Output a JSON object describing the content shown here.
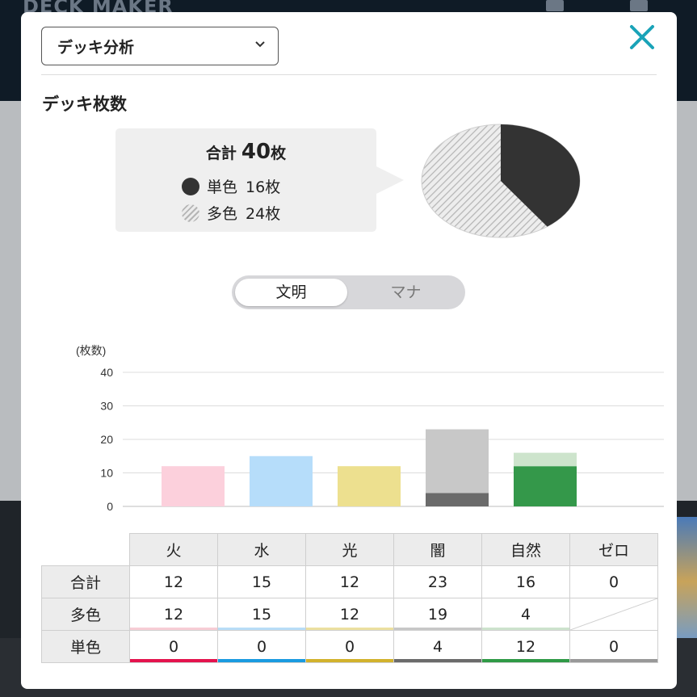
{
  "background": {
    "logo_text": "DECK MAKER"
  },
  "modal": {
    "select": {
      "value": "デッキ分析"
    },
    "section_title": "デッキ枚数",
    "summary": {
      "total_label": "合計",
      "total_value": "40",
      "unit": "枚",
      "mono": {
        "label": "単色",
        "value": "16枚",
        "count": 16
      },
      "multi": {
        "label": "多色",
        "value": "24枚",
        "count": 24
      }
    },
    "toggle": {
      "options": [
        "文明",
        "マナ"
      ],
      "active": 0
    },
    "colors": {
      "close_icon": "#1aa3b8",
      "pie_mono": "#333333",
      "pie_multi_hatch": "#b5b5b5"
    },
    "table": {
      "columns": [
        "火",
        "水",
        "光",
        "闇",
        "自然",
        "ゼロ"
      ],
      "rows": [
        {
          "label": "合計",
          "values": [
            "12",
            "15",
            "12",
            "23",
            "16",
            "0"
          ]
        },
        {
          "label": "多色",
          "values": [
            "12",
            "15",
            "12",
            "19",
            "4",
            ""
          ]
        },
        {
          "label": "単色",
          "values": [
            "0",
            "0",
            "0",
            "4",
            "12",
            "0"
          ]
        }
      ]
    }
  },
  "chart_data": {
    "type": "bar",
    "stacked": true,
    "ylabel": "(枚数)",
    "ylim": [
      0,
      40
    ],
    "yticks": [
      0,
      10,
      20,
      30,
      40
    ],
    "grid": true,
    "categories": [
      "火",
      "水",
      "光",
      "闇",
      "自然",
      "ゼロ"
    ],
    "series": [
      {
        "values": [
          0,
          0,
          0,
          4,
          12,
          0
        ]
      },
      {
        "values": [
          12,
          15,
          12,
          19,
          4,
          0
        ]
      }
    ],
    "colors": {
      "dark": [
        "#ffffff",
        "#ffffff",
        "#ffffff",
        "#6b6b6b",
        "#34984a",
        "#ffffff"
      ],
      "light": [
        "#fcd0dc",
        "#b6ddfa",
        "#ede08f",
        "#c8c8c8",
        "#cde4cc",
        "#ffffff"
      ]
    }
  }
}
